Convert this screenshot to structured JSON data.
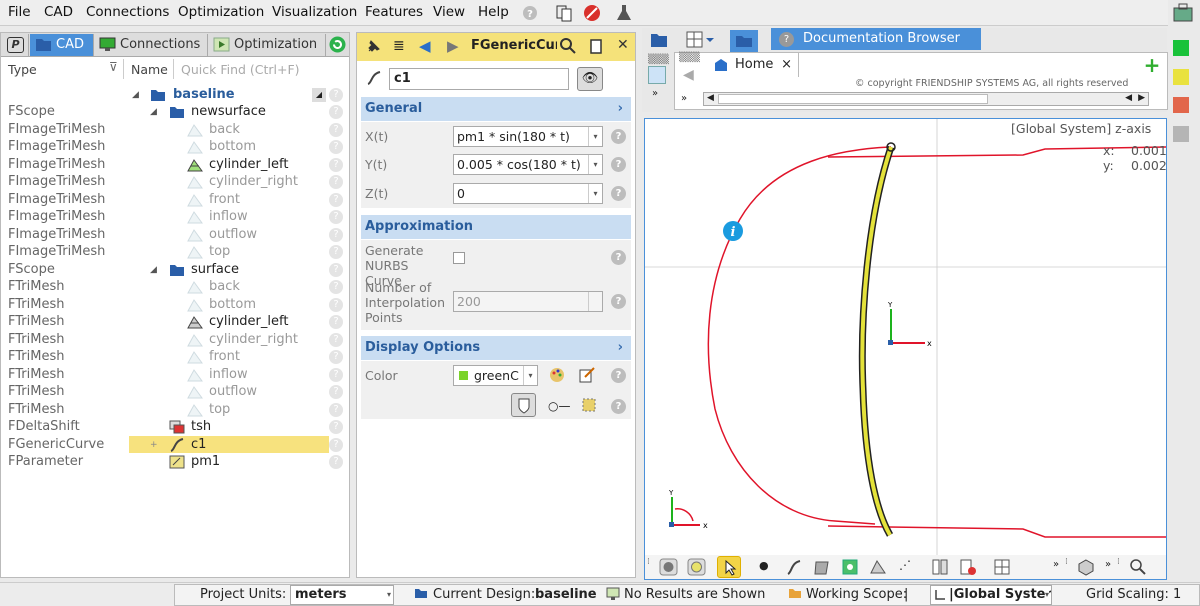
{
  "menu": {
    "file": "File",
    "cad": "CAD",
    "connections": "Connections",
    "optimization": "Optimization",
    "visualization": "Visualization",
    "features": "Features",
    "view": "View",
    "help": "Help"
  },
  "left_tabs": {
    "p": "P",
    "cad": "CAD",
    "connections": "Connections",
    "optimization": "Optimization"
  },
  "tree_header": {
    "type": "Type",
    "name": "Name",
    "quick_find": "Quick Find (Ctrl+F)"
  },
  "tree_root": "baseline",
  "tree": [
    {
      "type": "FScope",
      "name": "newsurface",
      "level": 1,
      "icon": "folder-icon",
      "dim": false
    },
    {
      "type": "FImageTriMesh",
      "name": "back",
      "level": 2,
      "icon": "mesh-icon",
      "dim": true
    },
    {
      "type": "FImageTriMesh",
      "name": "bottom",
      "level": 2,
      "icon": "mesh-icon",
      "dim": true
    },
    {
      "type": "FImageTriMesh",
      "name": "cylinder_left",
      "level": 2,
      "icon": "mesh-green-icon",
      "dim": false
    },
    {
      "type": "FImageTriMesh",
      "name": "cylinder_right",
      "level": 2,
      "icon": "mesh-icon",
      "dim": true
    },
    {
      "type": "FImageTriMesh",
      "name": "front",
      "level": 2,
      "icon": "mesh-icon",
      "dim": true
    },
    {
      "type": "FImageTriMesh",
      "name": "inflow",
      "level": 2,
      "icon": "mesh-icon",
      "dim": true
    },
    {
      "type": "FImageTriMesh",
      "name": "outflow",
      "level": 2,
      "icon": "mesh-icon",
      "dim": true
    },
    {
      "type": "FImageTriMesh",
      "name": "top",
      "level": 2,
      "icon": "mesh-icon",
      "dim": true
    },
    {
      "type": "FScope",
      "name": "surface",
      "level": 1,
      "icon": "folder-icon",
      "dim": false
    },
    {
      "type": "FTriMesh",
      "name": "back",
      "level": 2,
      "icon": "mesh-icon",
      "dim": true
    },
    {
      "type": "FTriMesh",
      "name": "bottom",
      "level": 2,
      "icon": "mesh-icon",
      "dim": true
    },
    {
      "type": "FTriMesh",
      "name": "cylinder_left",
      "level": 2,
      "icon": "mesh-gray-icon",
      "dim": false
    },
    {
      "type": "FTriMesh",
      "name": "cylinder_right",
      "level": 2,
      "icon": "mesh-icon",
      "dim": true
    },
    {
      "type": "FTriMesh",
      "name": "front",
      "level": 2,
      "icon": "mesh-icon",
      "dim": true
    },
    {
      "type": "FTriMesh",
      "name": "inflow",
      "level": 2,
      "icon": "mesh-icon",
      "dim": true
    },
    {
      "type": "FTriMesh",
      "name": "outflow",
      "level": 2,
      "icon": "mesh-icon",
      "dim": true
    },
    {
      "type": "FTriMesh",
      "name": "top",
      "level": 2,
      "icon": "mesh-icon",
      "dim": true
    },
    {
      "type": "FDeltaShift",
      "name": "tsh",
      "level": 1,
      "icon": "shift-icon",
      "dim": false
    },
    {
      "type": "FGenericCurve",
      "name": "c1",
      "level": 1,
      "icon": "curve-icon",
      "dim": false,
      "selected": true
    },
    {
      "type": "FParameter",
      "name": "pm1",
      "level": 1,
      "icon": "parameter-icon",
      "dim": false
    }
  ],
  "editor": {
    "title": "FGenericCur",
    "name": "c1",
    "general": "General",
    "x_label": "X(t)",
    "x_value": "pm1 * sin(180 * t)",
    "y_label": "Y(t)",
    "y_value": "0.005 * cos(180 * t)",
    "z_label": "Z(t)",
    "z_value": "0",
    "approximation": "Approximation",
    "nurbs_label": "Generate NURBS Curve",
    "interp_label": "Number of Interpolation Points",
    "interp_value": "200",
    "display_options": "Display Options",
    "color_label": "Color",
    "color_value": "greenC"
  },
  "browser": {
    "tab": "Documentation Browser",
    "home": "Home",
    "copyright": "© copyright FRIENDSHIP SYSTEMS AG, all rights reserved"
  },
  "viewport": {
    "system": "[Global System] z-axis",
    "x_label": "x:",
    "x_value": "0.001",
    "y_label": "y:",
    "y_value": "0.002"
  },
  "status": {
    "units_label": "Project Units:",
    "units": "meters",
    "design_label": "Current Design:",
    "design": "baseline",
    "results": "No Results are Shown",
    "scope_label": "Working Scope:",
    "scope": "|",
    "system": "|Global Systen",
    "grid": "Grid Scaling: 1"
  },
  "colors": {
    "accent": "#4a90d9",
    "selection": "#f7e27e",
    "curve": "#e0142a",
    "highlight": "#e4e23a"
  }
}
